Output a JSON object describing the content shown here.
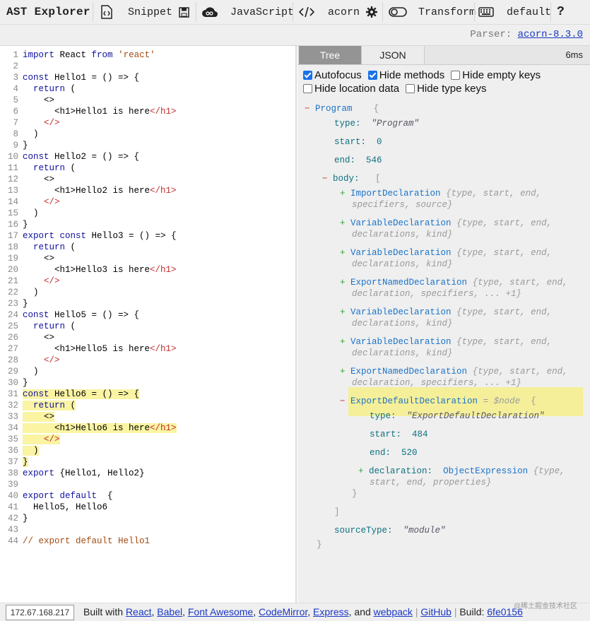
{
  "toolbar": {
    "brand": "AST Explorer",
    "snippet": "Snippet",
    "language": "JavaScript",
    "parser": "acorn",
    "transform": "Transform",
    "keymap": "default",
    "help": "?"
  },
  "parser_info": {
    "label": "Parser:",
    "link": "acorn-8.3.0"
  },
  "editor": {
    "lines": [
      "import React from 'react'",
      "",
      "const Hello1 = () => {",
      "  return (",
      "    <>",
      "      <h1>Hello1 is here</h1>",
      "    </>",
      "  )",
      "}",
      "const Hello2 = () => {",
      "  return (",
      "    <>",
      "      <h1>Hello2 is here</h1>",
      "    </>",
      "  )",
      "}",
      "export const Hello3 = () => {",
      "  return (",
      "    <>",
      "      <h1>Hello3 is here</h1>",
      "    </>",
      "  )",
      "}",
      "const Hello5 = () => {",
      "  return (",
      "    <>",
      "      <h1>Hello5 is here</h1>",
      "    </>",
      "  )",
      "}",
      "const Hello6 = () => {",
      "  return (",
      "    <>",
      "      <h1>Hello6 is here</h1>",
      "    </>",
      "  )",
      "}",
      "export {Hello1, Hello2}",
      "",
      "export default  {",
      "  Hello5, Hello6",
      "}",
      "",
      "// export default Hello1"
    ],
    "highlighted_lines": [
      31,
      32,
      33,
      34,
      35,
      36,
      37
    ]
  },
  "panel": {
    "tabs": [
      "Tree",
      "JSON"
    ],
    "active_tab": "Tree",
    "time": "6ms",
    "options": [
      {
        "label": "Autofocus",
        "checked": true
      },
      {
        "label": "Hide methods",
        "checked": true
      },
      {
        "label": "Hide empty keys",
        "checked": false
      },
      {
        "label": "Hide location data",
        "checked": false
      },
      {
        "label": "Hide type keys",
        "checked": false
      }
    ]
  },
  "tree": {
    "program": "Program",
    "type_key": "type:",
    "type_val": "\"Program\"",
    "start_key": "start:",
    "start_val": "0",
    "end_key": "end:",
    "end_val": "546",
    "body_key": "body:",
    "items": [
      {
        "name": "ImportDeclaration",
        "l1": "{type, start, end,",
        "l2": "specifiers, source}"
      },
      {
        "name": "VariableDeclaration",
        "l1": "{type, start, end,",
        "l2": "declarations, kind}"
      },
      {
        "name": "VariableDeclaration",
        "l1": "{type, start, end,",
        "l2": "declarations, kind}"
      },
      {
        "name": "ExportNamedDeclaration",
        "l1": "{type, start, end,",
        "l2": "declaration, specifiers, ... +1}"
      },
      {
        "name": "VariableDeclaration",
        "l1": "{type, start, end,",
        "l2": "declarations, kind}"
      },
      {
        "name": "VariableDeclaration",
        "l1": "{type, start, end,",
        "l2": "declarations, kind}"
      },
      {
        "name": "ExportNamedDeclaration",
        "l1": "{type, start, end,",
        "l2": "declaration, specifiers, ... +1}"
      }
    ],
    "export_default": {
      "name": "ExportDefaultDeclaration",
      "ref": "= $node",
      "type_val": "\"ExportDefaultDeclaration\"",
      "start_val": "484",
      "end_val": "520",
      "decl_key": "declaration:",
      "decl_val": "ObjectExpression",
      "decl_l1": "{type,",
      "decl_l2": "start, end, properties}"
    },
    "source_type_key": "sourceType:",
    "source_type_val": "\"module\""
  },
  "footer": {
    "built_with": "Built with",
    "links": [
      "React",
      "Babel",
      "Font Awesome",
      "CodeMirror",
      "Express",
      "webpack"
    ],
    "and": "and",
    "github": "GitHub",
    "build_label": "Build:",
    "build": "6fe0156",
    "ip": "172.67.168.217",
    "watermark": "@稀土掘金技术社区"
  },
  "colors": {
    "highlight": "#faf4a3",
    "link": "#1a38c4",
    "active_tab": "#949494"
  }
}
